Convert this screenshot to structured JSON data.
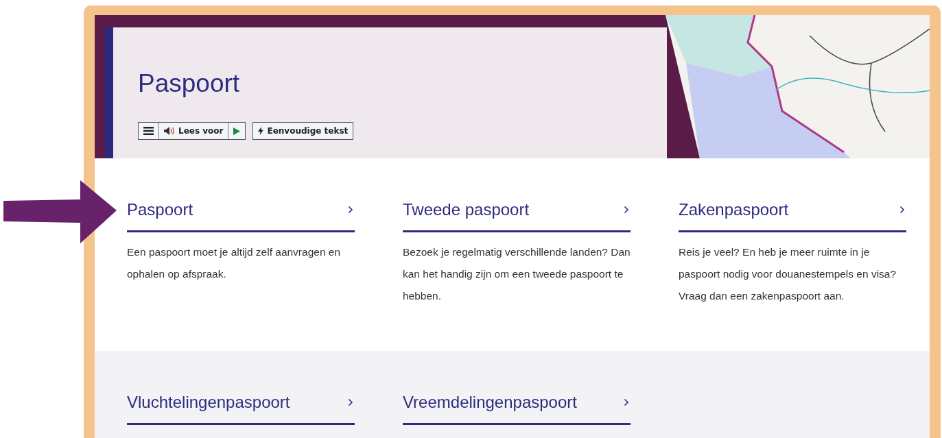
{
  "hero": {
    "title": "Paspoort",
    "toolbar": {
      "read_aloud": "Lees voor",
      "simple_text": "Eenvoudige tekst"
    }
  },
  "cards": [
    {
      "title": "Paspoort",
      "description": "Een paspoort moet je altijd zelf aanvragen en ophalen op afspraak."
    },
    {
      "title": "Tweede paspoort",
      "description": "Bezoek je regelmatig verschillende landen? Dan kan het handig zijn om een tweede paspoort te hebben."
    },
    {
      "title": "Zakenpaspoort",
      "description": "Reis je veel? En heb je meer ruimte in je paspoort nodig voor douanestempels en visa? Vraag dan een zakenpaspoort aan."
    }
  ],
  "more_cards": [
    {
      "title": "Vluchtelingenpaspoort"
    },
    {
      "title": "Vreemdelingenpaspoort"
    }
  ]
}
